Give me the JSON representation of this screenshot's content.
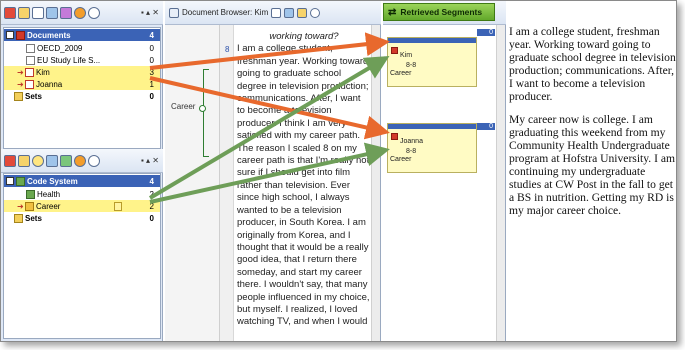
{
  "left_top_panel": {
    "rows": [
      {
        "label": "Documents",
        "count": "4"
      },
      {
        "label": "OECD_2009",
        "count": "0"
      },
      {
        "label": "EU Study Life S...",
        "count": "0"
      },
      {
        "label": "Kim",
        "count": "3"
      },
      {
        "label": "Joanna",
        "count": "1"
      },
      {
        "label": "Sets",
        "count": "0"
      }
    ]
  },
  "left_bottom_panel": {
    "rows": [
      {
        "label": "Code System",
        "count": "4"
      },
      {
        "label": "Health",
        "count": "2"
      },
      {
        "label": "Career",
        "count": "2"
      },
      {
        "label": "Sets",
        "count": "0"
      }
    ]
  },
  "document_browser": {
    "title": "Document Browser: Kim",
    "code_label": "Career",
    "line_number": "8",
    "question": "working toward?",
    "text": "I am a college student, freshman year.  Working toward going to graduate school degree in television production; communications.  After, I want to become a television producer. I think I am very satisfied with my career path.  The reason I scaled 8 on my career path is that I'm really not sure if I should get into film rather than television.  Ever since high school, I always wanted to be a television producer, in South Korea.  I am originally from Korea, and I  thought that it would be a really good idea, that I return there someday, and start my career there.  I wouldn't say, that many people influenced in my choice, but myself.  I realized, I loved watching TV, and when I would"
  },
  "retrieved_segments": {
    "title": "Retrieved Segments",
    "segments": [
      {
        "num": "0",
        "doc": "Kim",
        "ref": "8-8",
        "code": "Career"
      },
      {
        "num": "0",
        "doc": "Joanna",
        "ref": "8-8",
        "code": "Career"
      }
    ]
  },
  "segment_text": {
    "paragraph1": "I am a college student, freshman year.  Working toward going to graduate school degree in television production; communications.  After, I want to become a television producer.",
    "paragraph2": "My career now is college. I am graduating this weekend from my Community Health Undergraduate program at Hofstra University.  I am continuing my undergraduate studies at CW Post in the fall to get a BS in nutrition.  Getting my RD is my major career choice."
  },
  "colors": {
    "orange_arrow": "#e8692d",
    "green_arrow": "#6e9e58",
    "highlight": "#fff38a",
    "selection_blue": "#3b63b6"
  }
}
